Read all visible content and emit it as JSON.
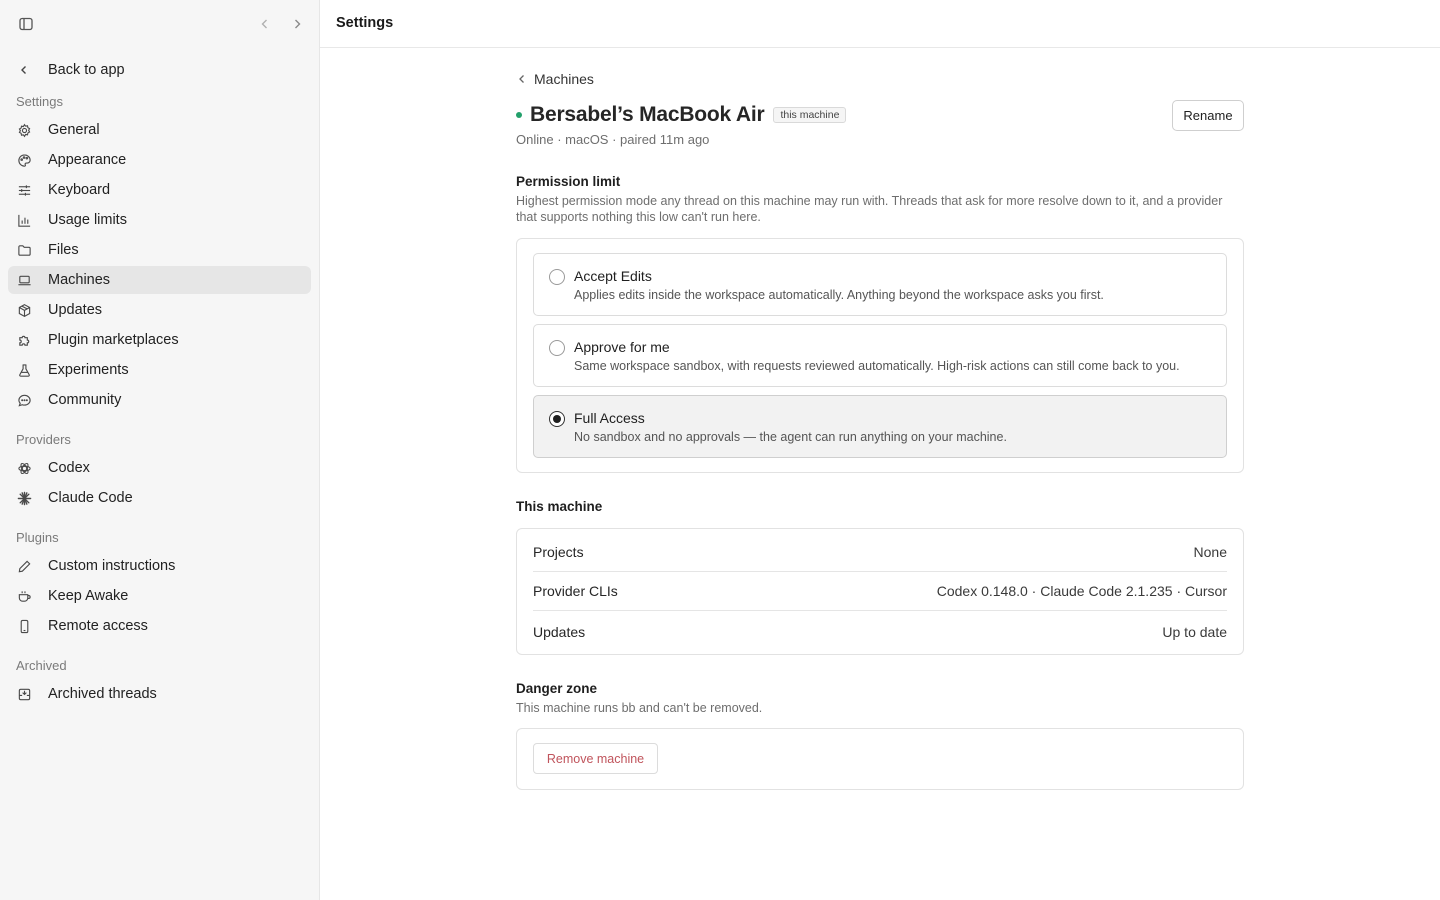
{
  "topbar": {
    "title": "Settings"
  },
  "sidebar": {
    "back_label": "Back to app",
    "settings_heading": "Settings",
    "settings_items": [
      {
        "label": "General",
        "icon": "gear-icon"
      },
      {
        "label": "Appearance",
        "icon": "palette-icon"
      },
      {
        "label": "Keyboard",
        "icon": "sliders-icon"
      },
      {
        "label": "Usage limits",
        "icon": "bar-chart-icon"
      },
      {
        "label": "Files",
        "icon": "folder-icon"
      },
      {
        "label": "Machines",
        "icon": "laptop-icon",
        "active": true
      },
      {
        "label": "Updates",
        "icon": "package-icon"
      },
      {
        "label": "Plugin marketplaces",
        "icon": "puzzle-icon"
      },
      {
        "label": "Experiments",
        "icon": "flask-icon"
      },
      {
        "label": "Community",
        "icon": "chat-bubble-icon"
      }
    ],
    "providers_heading": "Providers",
    "provider_items": [
      {
        "label": "Codex",
        "icon": "openai-icon"
      },
      {
        "label": "Claude Code",
        "icon": "claude-burst-icon"
      }
    ],
    "plugins_heading": "Plugins",
    "plugin_items": [
      {
        "label": "Custom instructions",
        "icon": "pencil-icon"
      },
      {
        "label": "Keep Awake",
        "icon": "coffee-cup-icon"
      },
      {
        "label": "Remote access",
        "icon": "phone-icon"
      }
    ],
    "archived_heading": "Archived",
    "archived_items": [
      {
        "label": "Archived threads",
        "icon": "archive-icon"
      }
    ]
  },
  "main": {
    "breadcrumb": "Machines",
    "machine_name": "Bersabel’s MacBook Air",
    "badge": "this machine",
    "rename_label": "Rename",
    "subline": "Online · macOS · paired 11m ago",
    "status_color": "#22a06b",
    "permission": {
      "heading": "Permission limit",
      "description": "Highest permission mode any thread on this machine may run with. Threads that ask for more resolve down to it, and a provider that supports nothing this low can't run here.",
      "options": [
        {
          "label": "Accept Edits",
          "description": "Applies edits inside the workspace automatically. Anything beyond the workspace asks you first.",
          "selected": false
        },
        {
          "label": "Approve for me",
          "description": "Same workspace sandbox, with requests reviewed automatically. High-risk actions can still come back to you.",
          "selected": false
        },
        {
          "label": "Full Access",
          "description": "No sandbox and no approvals — the agent can run anything on your machine.",
          "selected": true
        }
      ]
    },
    "this_machine": {
      "heading": "This machine",
      "rows": [
        {
          "label": "Projects",
          "value": "None"
        },
        {
          "label": "Provider CLIs",
          "value": "Codex 0.148.0 · Claude Code 2.1.235 · Cursor"
        },
        {
          "label": "Updates",
          "value": "Up to date"
        }
      ]
    },
    "danger": {
      "heading": "Danger zone",
      "description": "This machine runs bb and can't be removed.",
      "remove_label": "Remove machine",
      "remove_color": "#c0545c"
    }
  }
}
